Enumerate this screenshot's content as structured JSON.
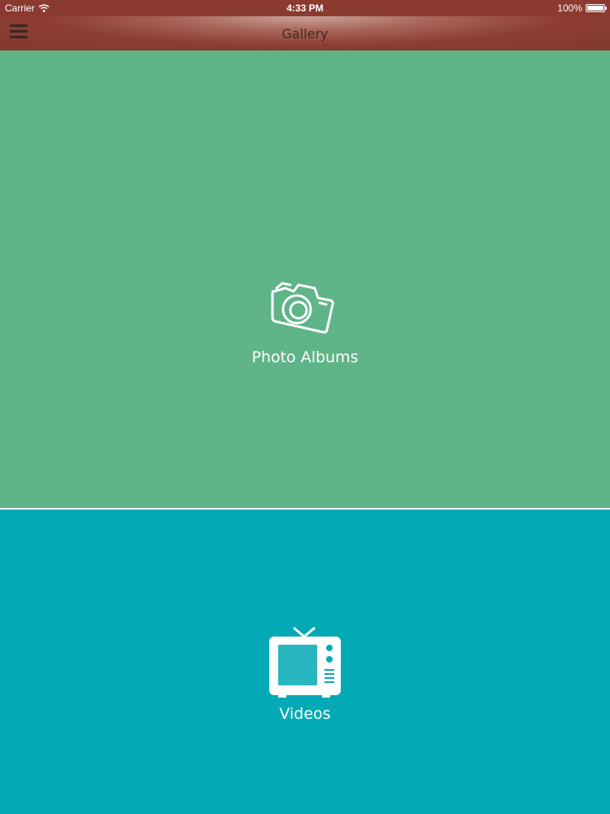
{
  "status_bar": {
    "carrier": "Carrier",
    "time": "4:33 PM",
    "battery": "100%",
    "battery_level": 1.0
  },
  "nav_bar": {
    "title": "Gallery",
    "menu_icon": "hamburger-menu-icon"
  },
  "sections": [
    {
      "label": "Photo Albums",
      "icon": "camera-icon",
      "color": "#5fb488"
    },
    {
      "label": "Videos",
      "icon": "tv-icon",
      "color": "#03aab5"
    }
  ],
  "colors": {
    "nav_bar": "#8d3e33",
    "divider": "#ffffff",
    "text": "#ffffff"
  }
}
